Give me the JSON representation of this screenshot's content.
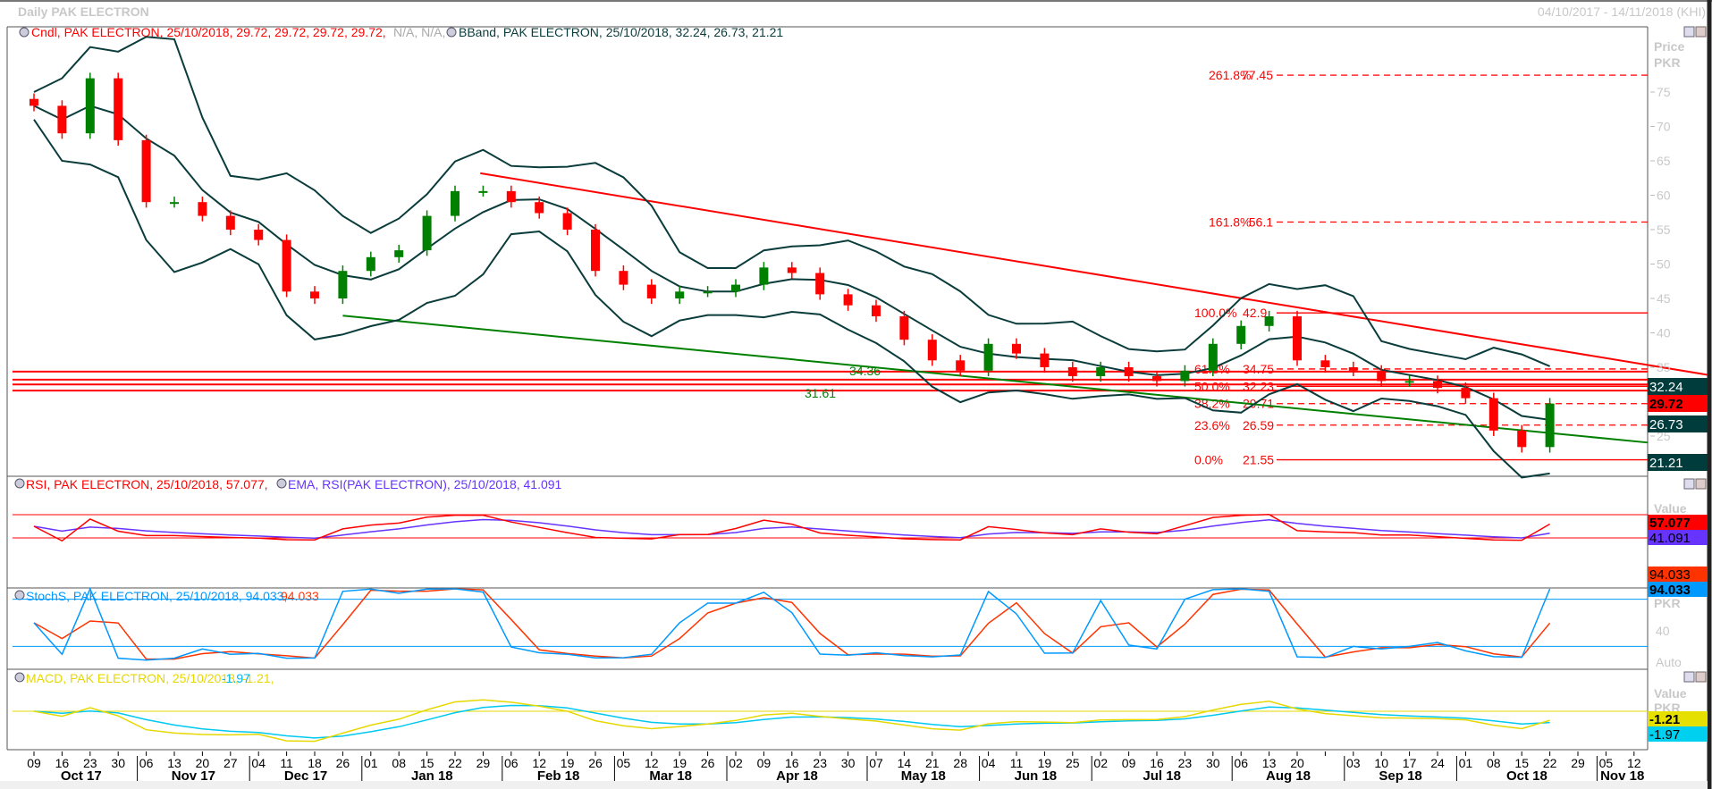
{
  "header": {
    "title": "Daily PAK ELECTRON",
    "range": "04/10/2017 - 14/11/2018 (KHI)"
  },
  "legends": {
    "candle": "Cndl, PAK ELECTRON, 25/10/2018, 29.72, 29.72, 29.72, 29.72,",
    "candle_na": "N/A, N/A,",
    "bband": "BBand, PAK ELECTRON, 25/10/2018, 32.24, 26.73, 21.21",
    "rsi": "RSI, PAK ELECTRON, 25/10/2018, 57.077,",
    "ema": "EMA, RSI(PAK ELECTRON), 25/10/2018, 41.091",
    "stoch": "StochS, PAK ELECTRON, 25/10/2018, 94.033,",
    "stoch2": "94.033",
    "macd": "MACD, PAK ELECTRON, 25/10/2018, -1.21,",
    "macd2": "-1.97"
  },
  "axis_panel": {
    "price": "Price",
    "pkr": "PKR",
    "value": "Value",
    "auto": "Auto",
    "stoch_tick": "40"
  },
  "value_boxes": {
    "bb_upper": "32.24",
    "close": "29.72",
    "bb_mid": "26.73",
    "bb_lower": "21.21",
    "rsi": "57.077",
    "ema": "41.091",
    "stoch_d": "94.033",
    "stoch_k": "94.033",
    "macd": "-1.21",
    "signal": "-1.97"
  },
  "colors": {
    "up": "#008000",
    "down": "#ff0000",
    "bband": "#0a3c3c",
    "rsi": "#ff0000",
    "ema": "#6633ff",
    "stoch_k": "#0099ff",
    "stoch_d": "#ff3300",
    "macd": "#e6d800",
    "signal": "#00c8f0"
  },
  "chart_data": {
    "type": "candlestick",
    "title": "Daily PAK ELECTRON",
    "ylabel": "Price PKR",
    "ylim": [
      20,
      80
    ],
    "yticks": [
      "75",
      "70",
      "65",
      "60",
      "55",
      "50",
      "45",
      "40",
      "35",
      "30",
      "25"
    ],
    "x_ticks": [
      "09",
      "16",
      "23",
      "30",
      "06",
      "13",
      "20",
      "27",
      "04",
      "11",
      "18",
      "26",
      "01",
      "08",
      "15",
      "22",
      "29",
      "06",
      "12",
      "19",
      "26",
      "05",
      "12",
      "19",
      "26",
      "02",
      "09",
      "16",
      "23",
      "30",
      "07",
      "14",
      "21",
      "28",
      "04",
      "11",
      "19",
      "25",
      "02",
      "09",
      "16",
      "23",
      "30",
      "06",
      "13",
      "20",
      "",
      "03",
      "10",
      "17",
      "24",
      "01",
      "08",
      "15",
      "22",
      "29",
      "05",
      "12"
    ],
    "months": [
      {
        "label": "Oct 17",
        "start": 0,
        "end": 4
      },
      {
        "label": "Nov 17",
        "start": 4,
        "end": 8
      },
      {
        "label": "Dec 17",
        "start": 8,
        "end": 12
      },
      {
        "label": "Jan 18",
        "start": 12,
        "end": 17
      },
      {
        "label": "Feb 18",
        "start": 17,
        "end": 21
      },
      {
        "label": "Mar 18",
        "start": 21,
        "end": 25
      },
      {
        "label": "Apr 18",
        "start": 25,
        "end": 30
      },
      {
        "label": "May 18",
        "start": 30,
        "end": 34
      },
      {
        "label": "Jun 18",
        "start": 34,
        "end": 38
      },
      {
        "label": "Jul 18",
        "start": 38,
        "end": 43
      },
      {
        "label": "Aug 18",
        "start": 43,
        "end": 47
      },
      {
        "label": "Sep 18",
        "start": 47,
        "end": 51
      },
      {
        "label": "Oct 18",
        "start": 51,
        "end": 56
      },
      {
        "label": "Nov 18",
        "start": 56,
        "end": 58
      }
    ],
    "weekly_close": [
      73,
      69,
      77,
      68,
      59,
      59,
      57,
      55,
      53.5,
      46,
      45,
      49,
      51,
      52,
      57,
      60.6,
      60.6,
      59,
      57.4,
      55,
      49,
      47,
      45,
      46,
      46,
      47,
      49.5,
      48.7,
      45.6,
      44,
      42.4,
      39,
      36,
      34.5,
      38.4,
      37,
      35,
      33.7,
      35,
      33.7,
      33,
      34.5,
      38.4,
      41,
      42.4,
      36,
      35,
      34.5,
      33,
      33,
      32,
      30.5,
      25.8,
      23.4,
      29.72
    ],
    "fibonacci": [
      {
        "pct": "261.8%",
        "value": "77.45",
        "price": 77.45,
        "style": "dashed"
      },
      {
        "pct": "161.8%",
        "value": "56.1",
        "price": 56.1,
        "style": "dashed"
      },
      {
        "pct": "100.0%",
        "value": "42.9",
        "price": 42.9,
        "style": "solid"
      },
      {
        "pct": "61.8%",
        "value": "34.75",
        "price": 34.75,
        "style": "dashed"
      },
      {
        "pct": "50.0%",
        "value": "32.23",
        "price": 32.23,
        "style": "solid"
      },
      {
        "pct": "38.2%",
        "value": "29.71",
        "price": 29.71,
        "style": "dashed"
      },
      {
        "pct": "23.6%",
        "value": "26.59",
        "price": 26.59,
        "style": "dashed"
      },
      {
        "pct": "0.0%",
        "value": "21.55",
        "price": 21.55,
        "style": "solid"
      }
    ],
    "trendlines": [
      {
        "name": "resistance",
        "color": "#ff0000",
        "from": [
          15.9,
          63.2
        ],
        "to": [
          59.8,
          33.9
        ]
      },
      {
        "name": "support",
        "color": "#008000",
        "from": [
          11.0,
          42.5
        ],
        "to": [
          57.5,
          24.05
        ]
      }
    ],
    "horizontal_lines": [
      {
        "price": 34.36,
        "label": "34.36"
      },
      {
        "price": 33.2,
        "label": ""
      },
      {
        "price": 32.5,
        "label": ""
      },
      {
        "price": 31.61,
        "label": "31.61"
      }
    ],
    "rsi_levels": [
      70,
      30
    ],
    "stoch_levels": [
      80,
      20
    ]
  }
}
